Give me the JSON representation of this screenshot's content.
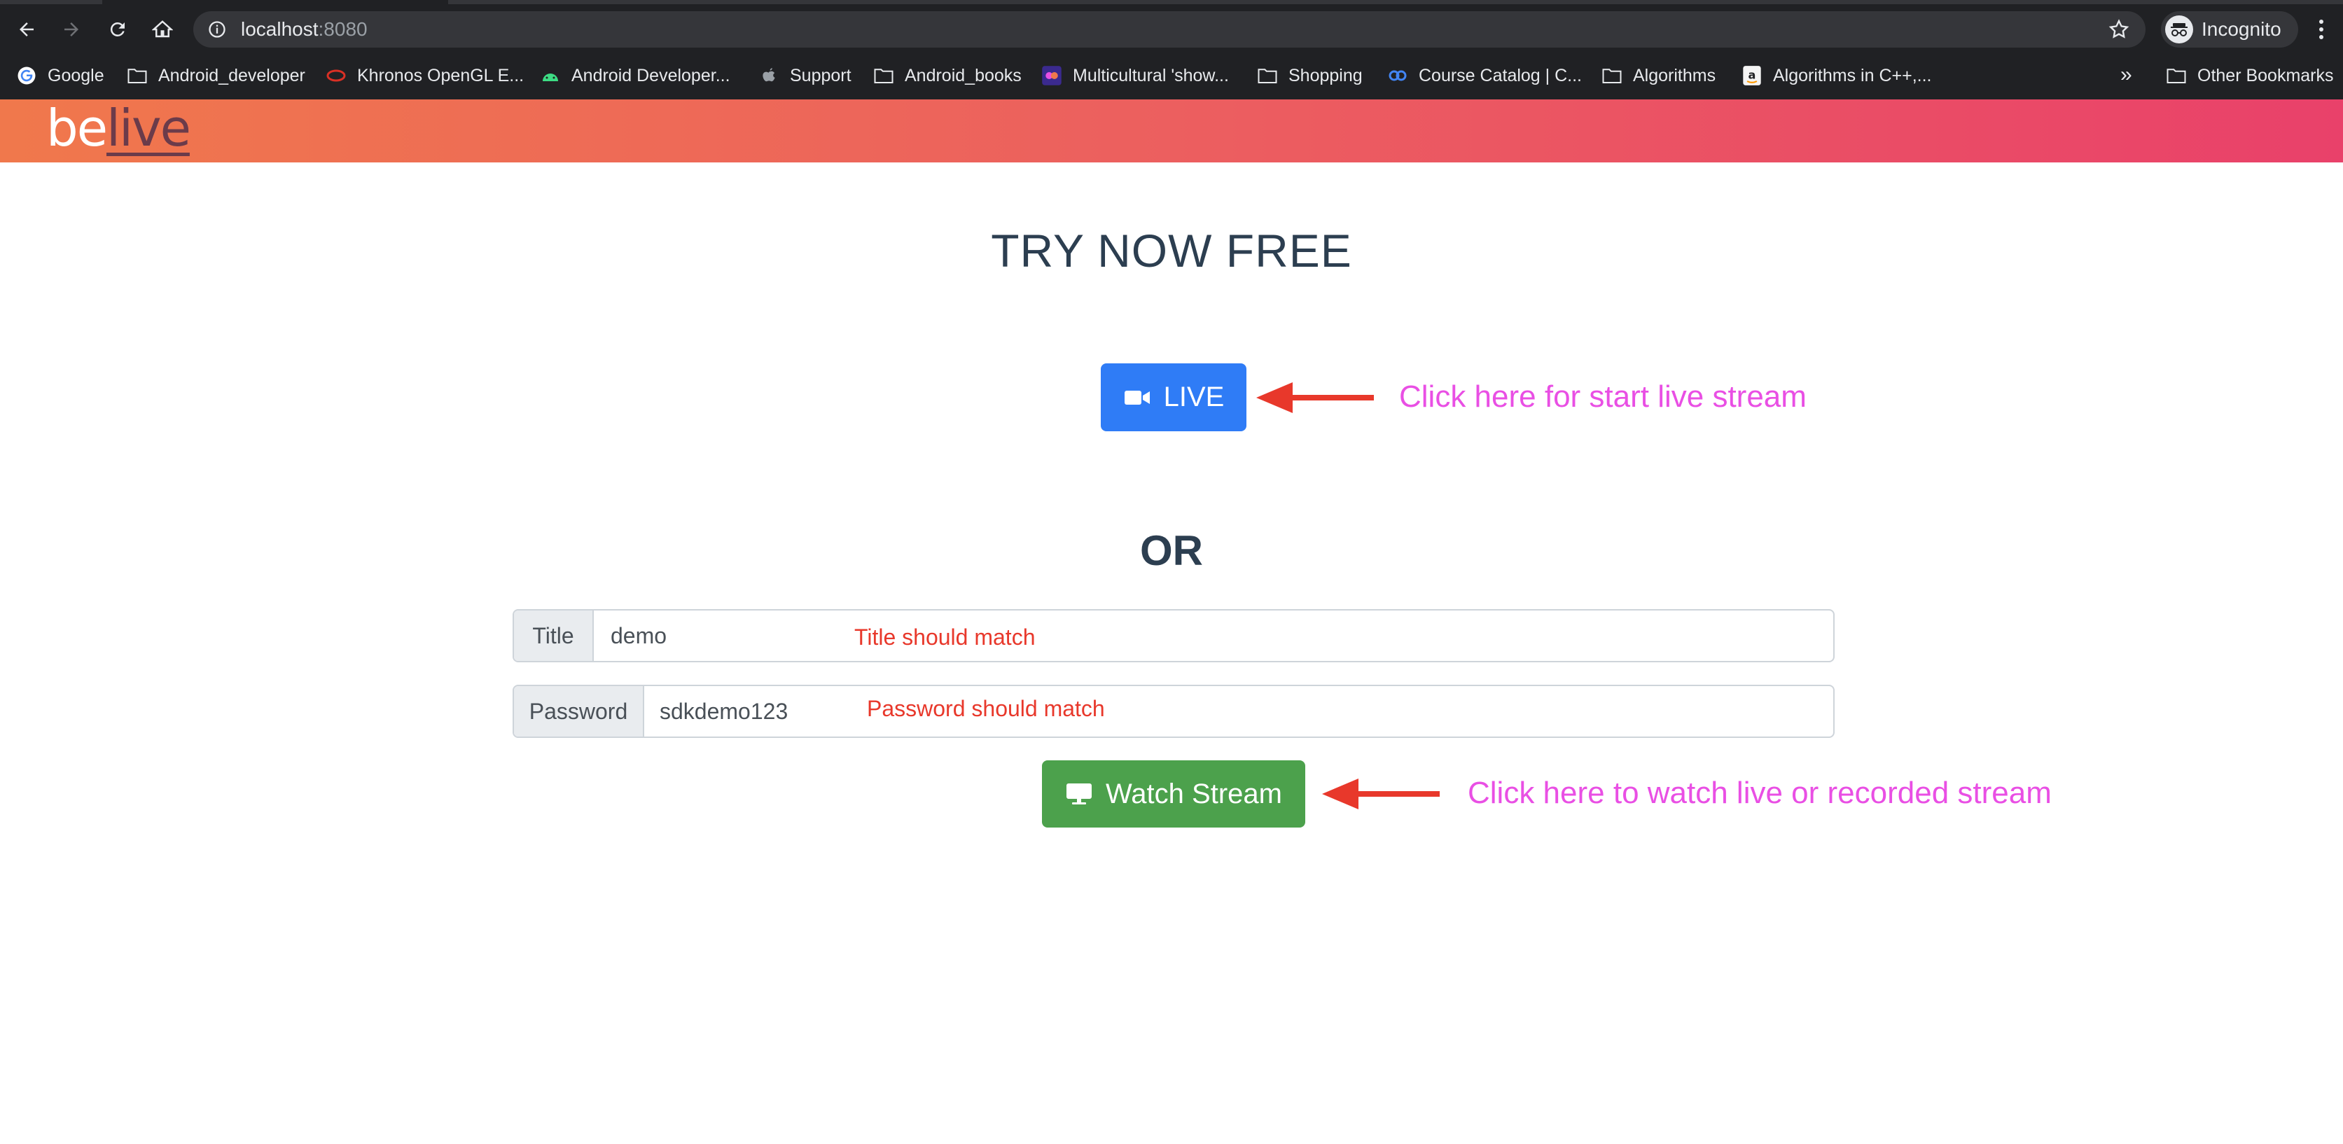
{
  "browser": {
    "url_host": "localhost",
    "url_port": ":8080",
    "profile_label": "Incognito",
    "bookmarks": [
      {
        "label": "Google",
        "icon": "google-icon"
      },
      {
        "label": "Android_developer",
        "icon": "folder-icon"
      },
      {
        "label": "Khronos OpenGL E...",
        "icon": "khronos-icon"
      },
      {
        "label": "Android Developer...",
        "icon": "android-icon"
      },
      {
        "label": "Support",
        "icon": "apple-icon"
      },
      {
        "label": "Android_books",
        "icon": "folder-icon"
      },
      {
        "label": "Multicultural 'show...",
        "icon": "site-icon"
      },
      {
        "label": "Shopping",
        "icon": "folder-icon"
      },
      {
        "label": "Course Catalog | C...",
        "icon": "coursera-icon"
      },
      {
        "label": "Algorithms",
        "icon": "folder-icon"
      },
      {
        "label": "Algorithms in C++,...",
        "icon": "amazon-icon"
      }
    ],
    "more_label": "»",
    "other_bookmarks": "Other Bookmarks"
  },
  "brand": {
    "logo_part1": "be",
    "logo_part2": "live",
    "gradient_start": "#f0784c",
    "gradient_end": "#e9416a"
  },
  "main": {
    "heading": "TRY NOW FREE",
    "live_button": "LIVE",
    "live_note": "Click here for start live stream",
    "or_label": "OR",
    "title_field": {
      "label": "Title",
      "value": "demo",
      "note": "Title should match"
    },
    "password_field": {
      "label": "Password",
      "value": "sdkdemo123",
      "note": "Password should match"
    },
    "watch_button": "Watch Stream",
    "watch_note": "Click here to watch live or recorded stream",
    "live_color": "#2f7cf6",
    "watch_color": "#4ca14c",
    "note_color": "#e94fe4",
    "arrow_color": "#e8382b"
  }
}
